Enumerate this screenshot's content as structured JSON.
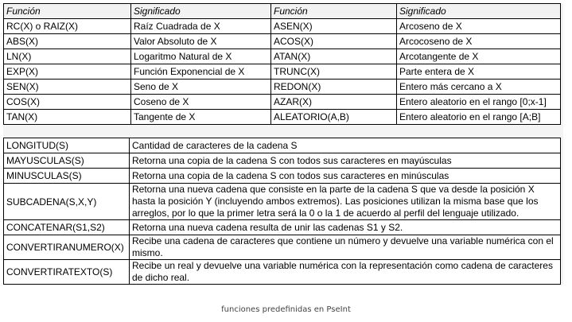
{
  "functions_table": {
    "headers": [
      "Función",
      "Significado",
      "Función",
      "Significado"
    ],
    "rows": [
      [
        "RC(X) o RAIZ(X)",
        "Raíz Cuadrada de X",
        "ASEN(X)",
        "Arcoseno de X"
      ],
      [
        "ABS(X)",
        "Valor Absoluto de X",
        "ACOS(X)",
        "Arcocoseno de X"
      ],
      [
        "LN(X)",
        "Logaritmo Natural de X",
        "ATAN(X)",
        "Arcotangente de X"
      ],
      [
        "EXP(X)",
        "Función Exponencial de X",
        "TRUNC(X)",
        "Parte entera de X"
      ],
      [
        "SEN(X)",
        "Seno de X",
        "REDON(X)",
        "Entero más cercano a X"
      ],
      [
        "COS(X)",
        "Coseno de X",
        "AZAR(X)",
        "Entero aleatorio en el rango [0;x-1]"
      ],
      [
        "TAN(X)",
        "Tangente de X",
        "ALEATORIO(A,B)",
        "Entero aleatorio en el rango [A;B]"
      ]
    ]
  },
  "string_functions_table": {
    "rows": [
      [
        "LONGITUD(S)",
        "Cantidad de caracteres de la cadena S"
      ],
      [
        "MAYUSCULAS(S)",
        "Retorna una copia de la cadena S con todos sus caracteres en mayúsculas"
      ],
      [
        "MINUSCULAS(S)",
        "Retorna una copia de la cadena S con todos sus caracteres en minúsculas"
      ],
      [
        "SUBCADENA(S,X,Y)",
        "Retorna una nueva cadena que consiste en la parte de la cadena S que va desde la posición X hasta la posición Y (incluyendo ambos extremos). Las posiciones utilizan la misma base que los arreglos, por lo que la primer letra será la 0 o la 1 de acuerdo al perfil del lenguaje utilizado."
      ],
      [
        "CONCATENAR(S1,S2)",
        "Retorna una nueva cadena resulta de unir las cadenas S1 y S2."
      ],
      [
        "CONVERTIRANUMERO(X)",
        "Recibe una cadena de caracteres que contiene un número y devuelve una variable numérica con el mismo."
      ],
      [
        "CONVERTIRATEXTO(S)",
        "Recibe un real y devuelve una variable numérica con la representación como cadena de caracteres de dicho real."
      ]
    ]
  },
  "caption": "funciones predefinidas en PseInt"
}
